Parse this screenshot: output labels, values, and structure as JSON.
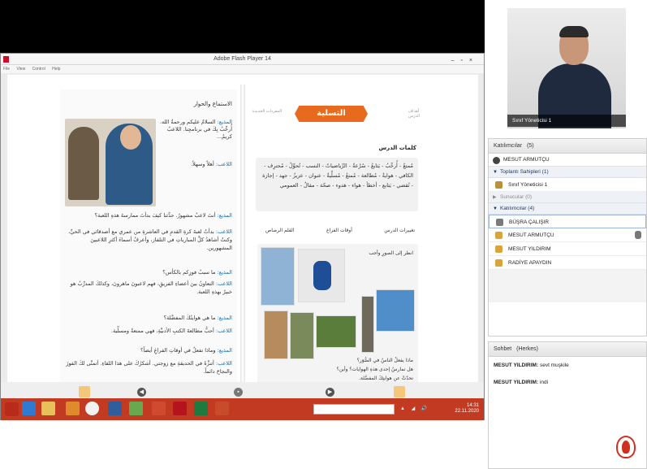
{
  "flash": {
    "title": "Adobe Flash Player 14",
    "menu": [
      "File",
      "View",
      "Control",
      "Help"
    ],
    "window_buttons": "–▫×"
  },
  "book": {
    "left": {
      "section_title": "الاستماع والحوار",
      "dialogue": [
        {
          "speaker": "المذيع:",
          "text": "السلامُ عليكم ورحمةُ الله. أُرحِّبُ بِكَ في برنامجِنا. اللاعبُ كريمٌ..."
        },
        {
          "speaker": "اللاعب:",
          "text": "أهلاً وسهلاً."
        },
        {
          "speaker": "المذيع:",
          "text": "أنتَ لاعبٌ مشهورٌ. حدِّثنا كيفَ بدأتَ ممارسةَ هذهِ اللعبة؟"
        },
        {
          "speaker": "اللاعب:",
          "text": "بدأتُ لعبةَ كرةِ القدمِ في العاشرةِ من عمري مع أصدقائي في الحيِّ، وكنتُ أشاهدُ كلَّ المبارياتِ في التلفاز، وأعرفُ أسماءَ أكثرِ اللاعبينَ المشهورين."
        },
        {
          "speaker": "المذيع:",
          "text": "ما سببُ فوزِكم بالكأس؟"
        },
        {
          "speaker": "اللاعب:",
          "text": "التعاونُ بينَ أعضاءِ الفريقِ، فهم لاعبونَ ماهرونَ، وكذلكَ المدرِّبُ هو خبيرٌ بهذهِ اللعبة."
        },
        {
          "speaker": "المذيع:",
          "text": "ما هي هوايتُكَ المفضَّلة؟"
        },
        {
          "speaker": "اللاعب:",
          "text": "أحبُّ مطالعةَ الكتبِ الأدبيَّةِ، فهي ممتعةٌ ومسلِّية."
        },
        {
          "speaker": "المذيع:",
          "text": "وماذا تفعلُ في أوقاتِ الفراغِ أيضاً؟"
        },
        {
          "speaker": "اللاعب:",
          "text": "أتنزَّهُ في الحديقةِ مع زوجتي. أشكرُكَ على هذا اللقاءِ. أتمنَّى لكَ الفوزَ والنجاحَ دائماً."
        }
      ]
    },
    "right": {
      "lesson_title": "التسلية",
      "tag_left": "أهداف الدرس",
      "tag_right": "المفردات الجديدة",
      "vocab_heading": "كلمات الدرس",
      "vocab_text": "مُمتعٌ - أُرحِّبُ - يَتابعُ - سُرْعةٌ - الرِّياضياتُ - النسب - تُحوِّلُ - مُحترِف - الكافي - هوايةٌ - مُطالعة - مُمتعٌ - مُسلِّيةٌ - عنوان - عزيزٌ - جهد - إجازة - تُقضي - يَتابع - أخطأ - هواء - هدوء - صحّة - مقالٌ - العمومي",
      "word_options": [
        "أوقات الفراغ",
        "تغييرات الدرس",
        "القلم الرصاص"
      ],
      "activity_label": "انظر إلى الصورِ وأجب",
      "questions": [
        "ماذا يفعلُ الناسُ في الصُّوَر؟",
        "هل تمارسُ إحدى هذهِ الهوايات؟ وأين؟",
        "تحدّثْ عن هوايتِكَ المفضَّلة."
      ]
    }
  },
  "taskbar": {
    "tray": "▲ ◢ 🔊",
    "clock_time": "14:31",
    "clock_date": "22.11.2020"
  },
  "video": {
    "label": "Sınıf Yöneticisi 1"
  },
  "attendees": {
    "title": "Katılımcılar",
    "count": "(5)",
    "me": "MESUT ARMUTÇU",
    "groups": [
      {
        "label": "Toplantı Sahipleri (1)",
        "members": [
          "Sınıf Yöneticisi 1"
        ]
      },
      {
        "label": "Sunucular (0)",
        "members": []
      },
      {
        "label": "Katılımcılar (4)",
        "members": [
          "BÜŞRA ÇALIŞIR",
          "MESUT ARMUTÇU",
          "MESUT YILDIRIM",
          "RADİYE APAYDIN"
        ]
      }
    ]
  },
  "chat": {
    "title": "Sohbet",
    "scope": "(Herkes)",
    "messages": [
      {
        "sender": "MESUT YILDIRIM:",
        "text": "sevt muşkile"
      },
      {
        "sender": "MESUT YILDIRIM:",
        "text": "indi"
      }
    ]
  }
}
